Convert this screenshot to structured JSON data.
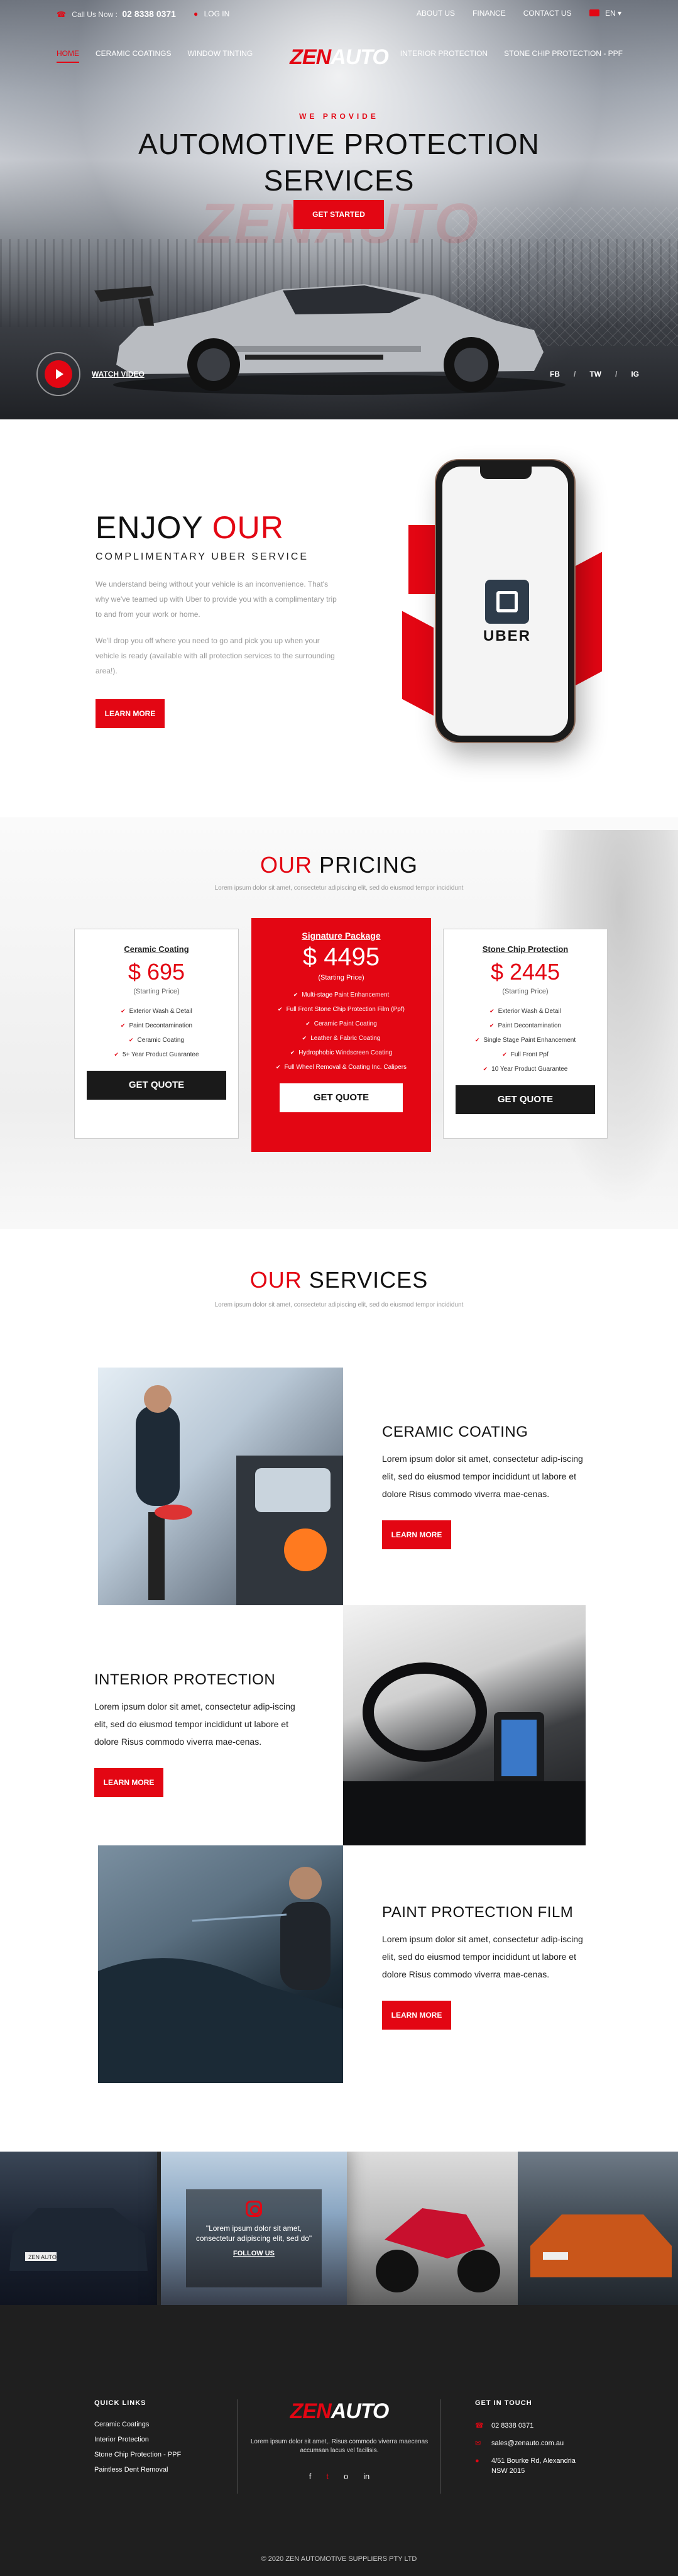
{
  "topbar": {
    "call_label": "Call Us Now :",
    "phone": "02 8338 0371",
    "login": "LOG IN",
    "right_links": [
      "ABOUT US",
      "FINANCE",
      "CONTACT US"
    ],
    "language": "EN"
  },
  "nav": {
    "left": [
      "HOME",
      "CERAMIC COATINGS",
      "WINDOW TINTING"
    ],
    "right": [
      "INTERIOR PROTECTION",
      "STONE CHIP PROTECTION - PPF"
    ],
    "active_index": 0
  },
  "logo": {
    "zen": "ZEN",
    "auto": "AUTO"
  },
  "hero": {
    "eyebrow": "WE PROVIDE",
    "title_line1": "AUTOMOTIVE PROTECTION",
    "title_line2": "SERVICES",
    "ghost_text": "ZENAUTO",
    "cta": "GET STARTED",
    "watch_video": "WATCH VIDEO",
    "social": [
      "FB",
      "TW",
      "IG"
    ]
  },
  "uber": {
    "title_a": "ENJOY ",
    "title_b": "OUR",
    "subtitle": "COMPLIMENTARY UBER SERVICE",
    "para1": "We understand being without your vehicle is an inconvenience. That's why we've teamed up with Uber to provide you with a complimentary trip to and from your work or home.",
    "para2": "We'll drop you off where you need to go and pick you up when your vehicle is ready (available with all protection services to the surrounding area!).",
    "button": "LEARN MORE",
    "app_word": "UBER"
  },
  "pricing": {
    "title_a": "OUR ",
    "title_b": "PRICING",
    "subtitle": "Lorem ipsum dolor sit amet, consectetur adipiscing elit, sed do eiusmod tempor incididunt",
    "plans": [
      {
        "name": "Ceramic Coating",
        "price": "$ 695",
        "starting": "(Starting Price)",
        "features": [
          "Exterior Wash & Detail",
          "Paint Decontamination",
          "Ceramic Coating",
          "5+ Year Product Guarantee"
        ],
        "button": "GET QUOTE"
      },
      {
        "name": "Signature Package",
        "price": "$ 4495",
        "starting": "(Starting Price)",
        "features": [
          "Multi-stage Paint Enhancement",
          "Full Front Stone Chip Protection Film (Ppf)",
          "Ceramic Paint Coating",
          "Leather & Fabric Coating",
          "Hydrophobic Windscreen Coating",
          "Full Wheel Removal & Coating Inc. Calipers"
        ],
        "button": "GET QUOTE"
      },
      {
        "name": "Stone Chip Protection",
        "price": "$ 2445",
        "starting": "(Starting Price)",
        "features": [
          "Exterior Wash & Detail",
          "Paint Decontamination",
          "Single Stage Paint Enhancement",
          "Full Front Ppf",
          "10 Year Product Guarantee"
        ],
        "button": "GET QUOTE"
      }
    ]
  },
  "services": {
    "title_a": "OUR ",
    "title_b": "SERVICES",
    "subtitle": "Lorem ipsum dolor sit amet, consectetur adipiscing elit, sed do eiusmod tempor incididunt",
    "items": [
      {
        "title": "CERAMIC COATING",
        "body": "Lorem ipsum dolor sit amet, consectetur adip-iscing elit, sed do eiusmod tempor incididunt ut labore et dolore Risus commodo viverra mae-cenas.",
        "button": "LEARN MORE"
      },
      {
        "title": "INTERIOR PROTECTION",
        "body": "Lorem ipsum dolor sit amet, consectetur adip-iscing elit, sed do eiusmod tempor incididunt ut labore et dolore Risus commodo viverra mae-cenas.",
        "button": "LEARN MORE"
      },
      {
        "title": "PAINT PROTECTION FILM",
        "body": "Lorem ipsum dolor sit amet, consectetur adip-iscing elit, sed do eiusmod tempor incididunt ut labore et dolore Risus commodo viverra mae-cenas.",
        "button": "LEARN MORE"
      }
    ]
  },
  "gallery": {
    "instagram_quote": "\"Lorem ipsum dolor sit amet, consectetur adipiscing elit, sed do\"",
    "follow": "FOLLOW US",
    "plate": "ZEN AUTO"
  },
  "footer": {
    "quick_links_title": "QUICK LINKS",
    "quick_links": [
      "Ceramic Coatings",
      "Interior Protection",
      "Stone Chip Protection - PPF",
      "Paintless Dent Removal"
    ],
    "desc": "Lorem ipsum dolor sit amet,. Risus commodo viverra maecenas accumsan lacus vel facilisis.",
    "social_icons": [
      "f",
      "t",
      "o",
      "in"
    ],
    "contact_title": "GET IN TOUCH",
    "contact": {
      "phone": "02 8338 0371",
      "email": "sales@zenauto.com.au",
      "address": "4/51 Bourke Rd, Alexandria NSW 2015"
    },
    "copyright": "© 2020 ZEN AUTOMOTIVE SUPPLIERS PTY LTD"
  },
  "colors": {
    "accent": "#e30613",
    "dark": "#1f1f1f"
  }
}
